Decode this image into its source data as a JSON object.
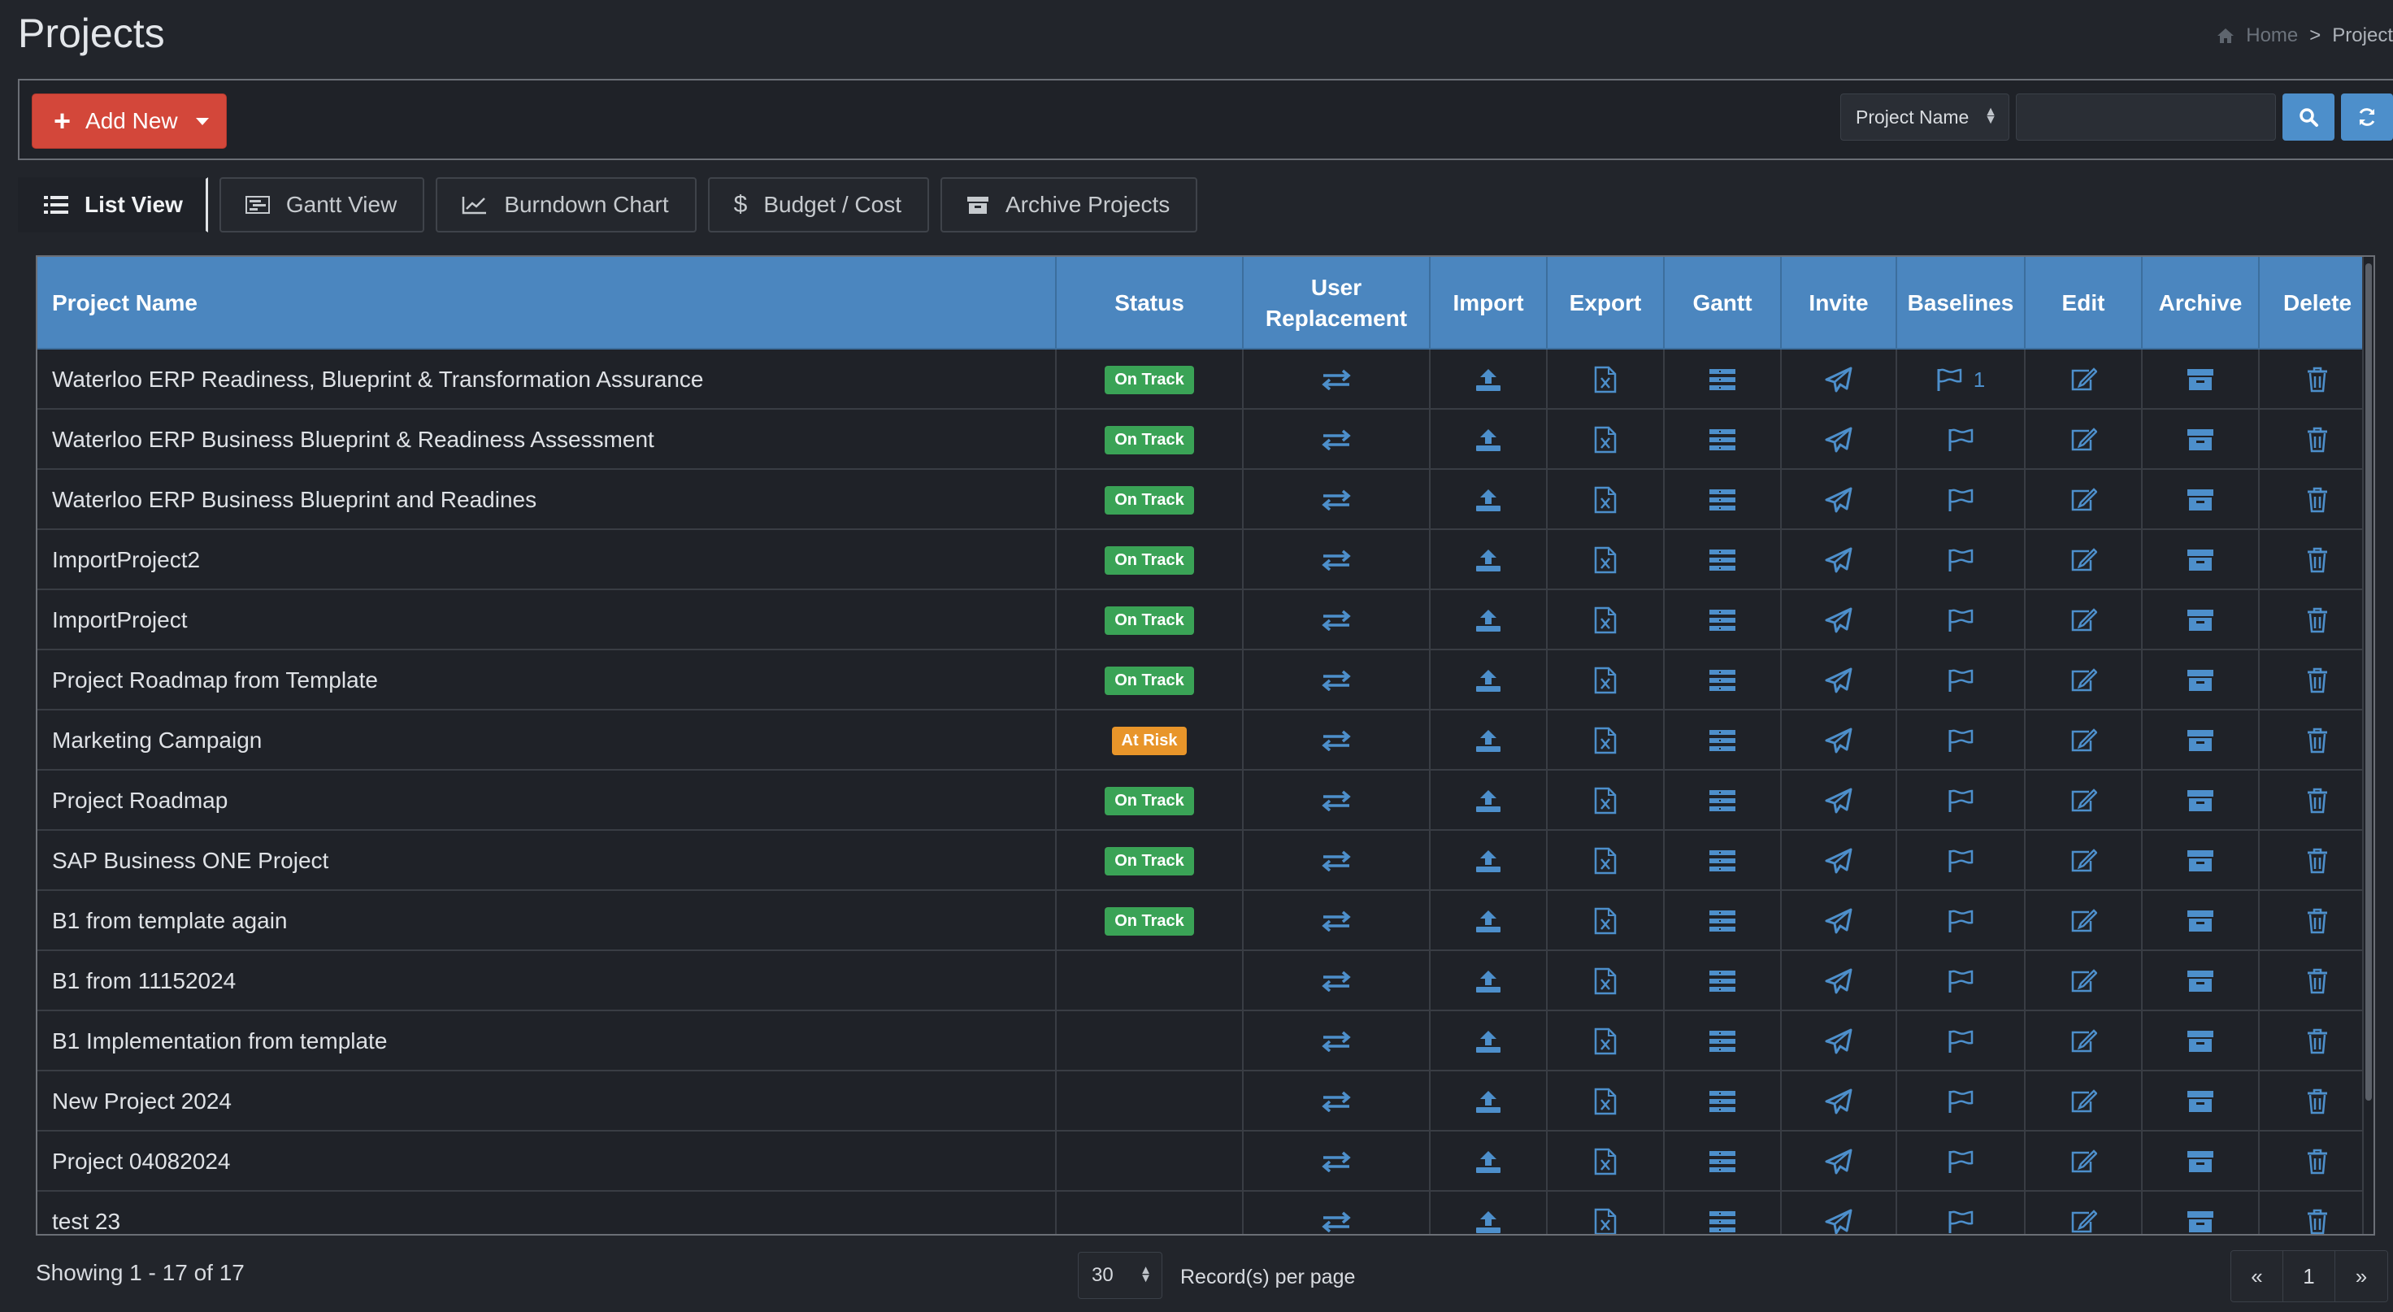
{
  "page": {
    "title": "Projects"
  },
  "breadcrumb": {
    "home": "Home",
    "separator": ">",
    "current": "Project"
  },
  "toolbar": {
    "add_label": "Add New",
    "search_field": "Project Name",
    "search_value": ""
  },
  "tabs": [
    {
      "label": "List View",
      "icon": "list-icon"
    },
    {
      "label": "Gantt View",
      "icon": "gantt-icon"
    },
    {
      "label": "Burndown Chart",
      "icon": "line-chart-icon"
    },
    {
      "label": "Budget / Cost",
      "icon": "dollar-icon"
    },
    {
      "label": "Archive Projects",
      "icon": "archive-box-icon"
    }
  ],
  "table": {
    "headers": {
      "name": "Project Name",
      "status": "Status",
      "user_replacement_1": "User",
      "user_replacement_2": "Replacement",
      "import": "Import",
      "export": "Export",
      "gantt": "Gantt",
      "invite": "Invite",
      "baselines": "Baselines",
      "edit": "Edit",
      "archive": "Archive",
      "delete": "Delete"
    },
    "rows": [
      {
        "name": "Waterloo ERP Readiness, Blueprint & Transformation Assurance",
        "status": "On Track",
        "baselines": "1"
      },
      {
        "name": "Waterloo ERP Business Blueprint & Readiness Assessment",
        "status": "On Track",
        "baselines": ""
      },
      {
        "name": "Waterloo ERP Business Blueprint and Readines",
        "status": "On Track",
        "baselines": ""
      },
      {
        "name": "ImportProject2",
        "status": "On Track",
        "baselines": ""
      },
      {
        "name": "ImportProject",
        "status": "On Track",
        "baselines": ""
      },
      {
        "name": "Project Roadmap from Template",
        "status": "On Track",
        "baselines": ""
      },
      {
        "name": "Marketing Campaign",
        "status": "At Risk",
        "baselines": ""
      },
      {
        "name": "Project Roadmap",
        "status": "On Track",
        "baselines": ""
      },
      {
        "name": "SAP Business ONE Project",
        "status": "On Track",
        "baselines": ""
      },
      {
        "name": "B1 from template again",
        "status": "On Track",
        "baselines": ""
      },
      {
        "name": "B1 from 11152024",
        "status": "",
        "baselines": ""
      },
      {
        "name": "B1 Implementation from template",
        "status": "",
        "baselines": ""
      },
      {
        "name": "New Project 2024",
        "status": "",
        "baselines": ""
      },
      {
        "name": "Project 04082024",
        "status": "",
        "baselines": ""
      },
      {
        "name": "test 23",
        "status": "",
        "baselines": ""
      }
    ]
  },
  "footer": {
    "showing": "Showing 1 - 17 of 17",
    "per_page_value": "30",
    "per_page_label": "Record(s) per page",
    "pager": {
      "prev": "«",
      "page": "1",
      "next": "»"
    }
  },
  "colors": {
    "accent": "#4b86bf",
    "icon": "#4d8fcb",
    "danger": "#d3473a",
    "on_track": "#3aa356",
    "at_risk": "#e8952a"
  }
}
